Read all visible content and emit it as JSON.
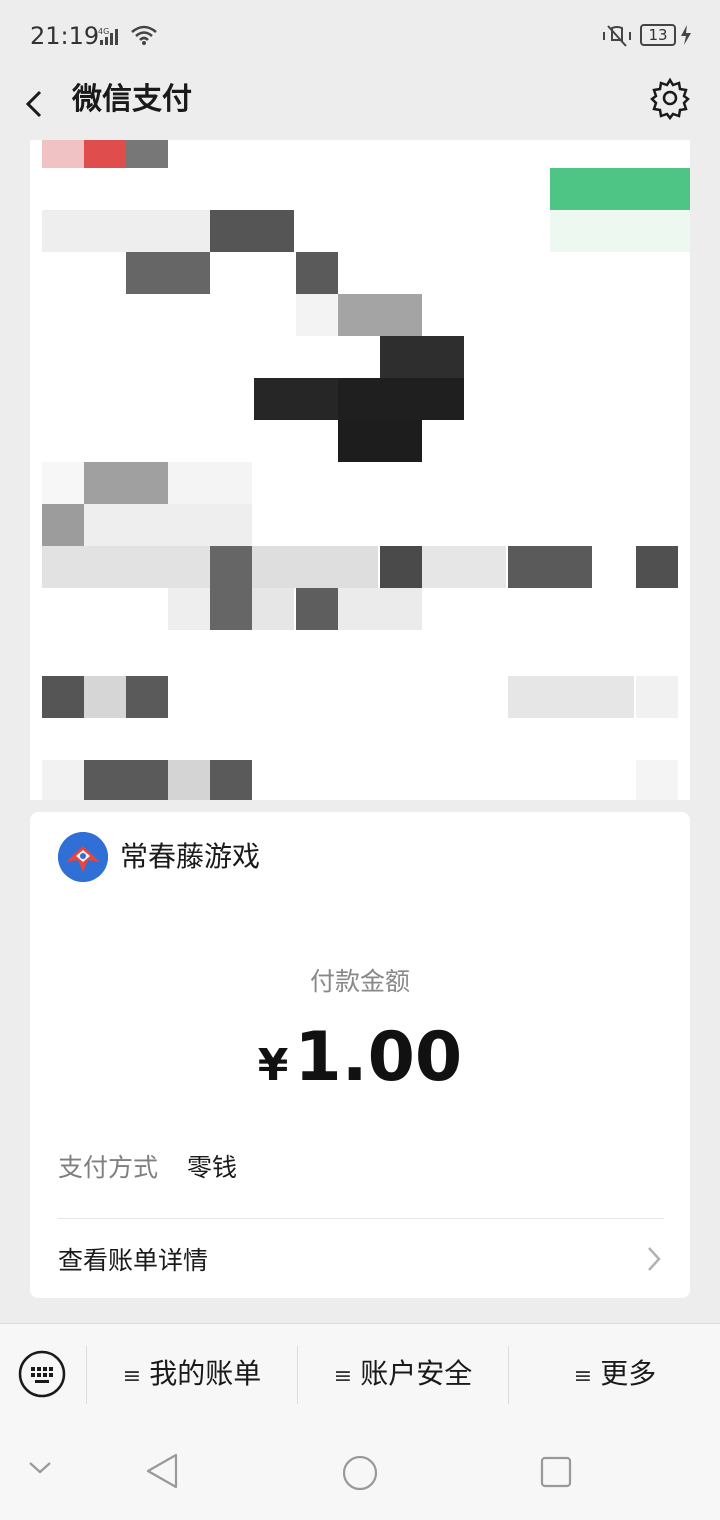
{
  "status_bar": {
    "time": "21:19",
    "network": "4G",
    "battery": "13"
  },
  "header": {
    "title": "微信支付"
  },
  "payment": {
    "merchant_name": "常春藤游戏",
    "amount_label": "付款金额",
    "currency": "¥",
    "amount": "1.00",
    "method_label": "支付方式",
    "method_value": "零钱",
    "bill_detail_label": "查看账单详情"
  },
  "bottom_menu": {
    "items": [
      {
        "label": "我的账单"
      },
      {
        "label": "账户安全"
      },
      {
        "label": "更多"
      }
    ]
  },
  "colors": {
    "background": "#ededed",
    "card": "#ffffff",
    "text": "#191919",
    "muted": "#888888"
  },
  "icons": [
    "back-icon",
    "settings-icon",
    "keyboard-icon",
    "chevron-right-icon",
    "menu-icon",
    "wifi-icon",
    "mute-icon"
  ]
}
